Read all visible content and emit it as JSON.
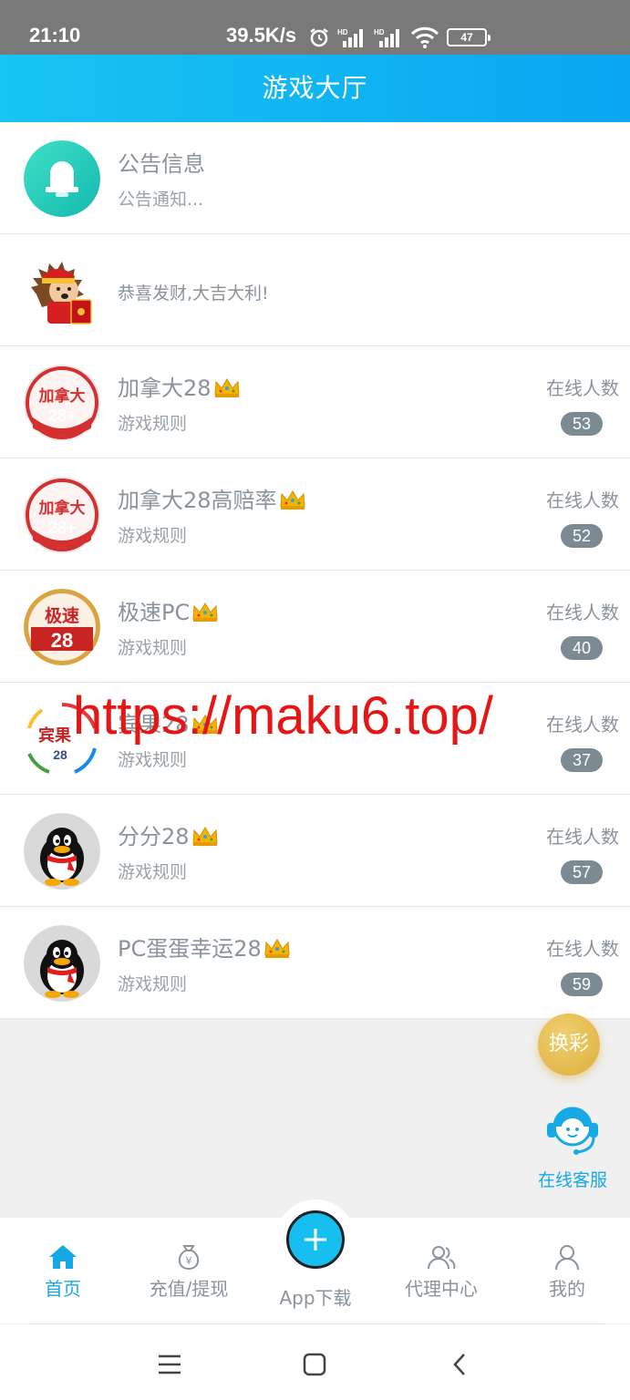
{
  "status_bar": {
    "time": "21:10",
    "speed": "39.5K/s",
    "battery": "47"
  },
  "header": {
    "title": "游戏大厅"
  },
  "notice": {
    "title": "公告信息",
    "subtitle": "公告通知..."
  },
  "greeting": {
    "text": "恭喜发财,大吉大利!"
  },
  "games": [
    {
      "title": "加拿大28",
      "rule": "游戏规则",
      "online_label": "在线人数",
      "count": "53"
    },
    {
      "title": "加拿大28高赔率",
      "rule": "游戏规则",
      "online_label": "在线人数",
      "count": "52"
    },
    {
      "title": "极速PC",
      "rule": "游戏规则",
      "online_label": "在线人数",
      "count": "40"
    },
    {
      "title": "宾果28",
      "rule": "游戏规则",
      "online_label": "在线人数",
      "count": "37"
    },
    {
      "title": "分分28",
      "rule": "游戏规则",
      "online_label": "在线人数",
      "count": "57"
    },
    {
      "title": "PC蛋蛋幸运28",
      "rule": "游戏规则",
      "online_label": "在线人数",
      "count": "59"
    }
  ],
  "logo_text": {
    "canada_top": "加拿大",
    "canada_bottom": "28+",
    "jisu_top": "极速",
    "jisu_bottom": "28",
    "bingo_top": "宾果",
    "bingo_bottom": "28"
  },
  "watermark": "https://maku6.top/",
  "float": {
    "switch_label": "换彩",
    "service_label": "在线客服"
  },
  "tabbar": {
    "home": "首页",
    "recharge": "充值/提现",
    "app": "App下载",
    "agent": "代理中心",
    "mine": "我的"
  },
  "colors": {
    "accent": "#17a9e6",
    "header_start": "#17c4f2",
    "header_end": "#0aa6f2",
    "badge": "#7c8a93",
    "watermark": "#e51616",
    "switch_gold": "#dcae3c"
  },
  "icons": {
    "notice": "bell-icon",
    "greeting": "hedgehog-avatar",
    "qq": "penguin-avatar",
    "crown": "crown-icon",
    "service": "headset-icon",
    "home": "home-icon",
    "recharge": "money-bag-icon",
    "app": "plus-icon",
    "agent": "users-icon",
    "mine": "user-icon"
  }
}
